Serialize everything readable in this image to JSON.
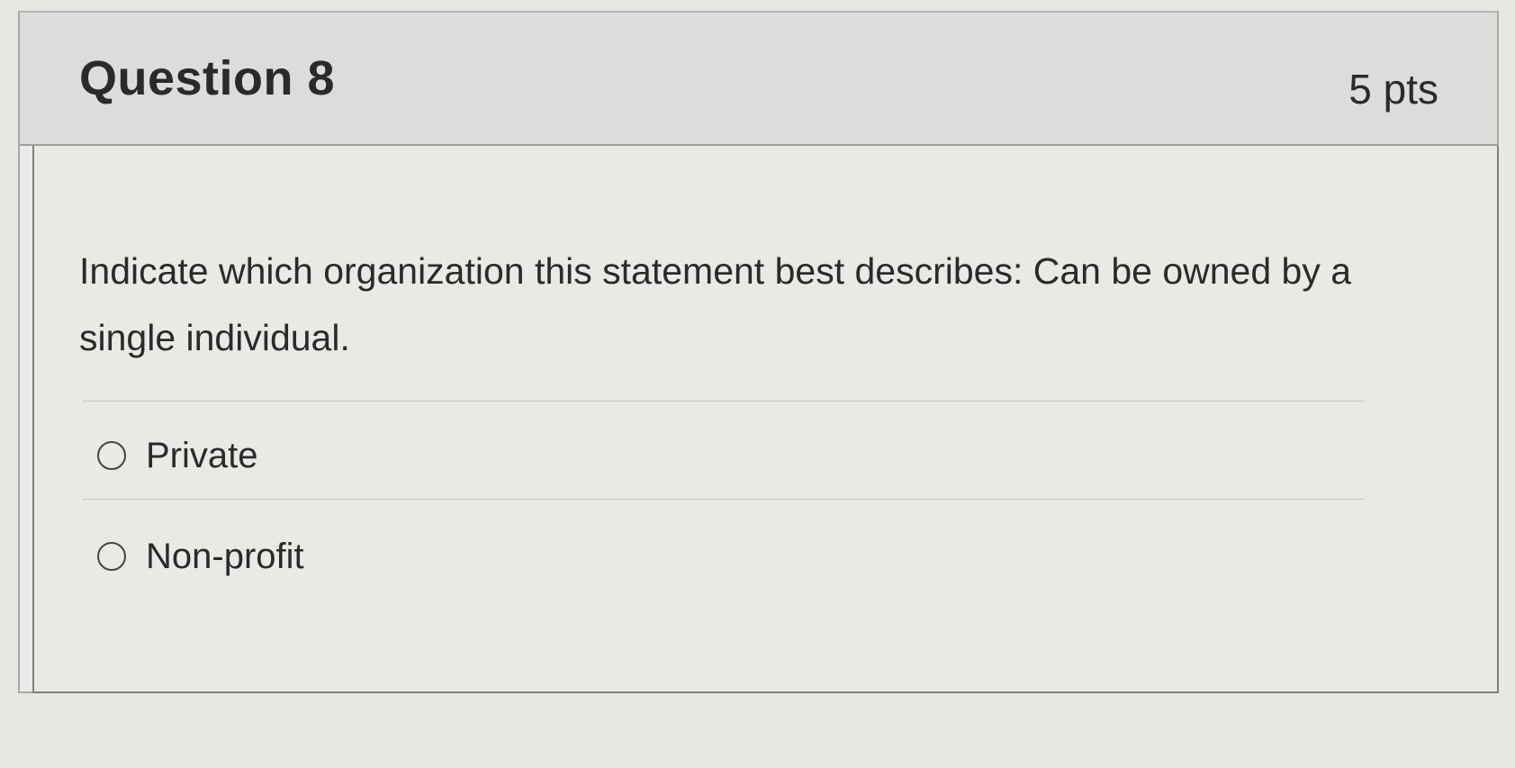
{
  "question": {
    "title": "Question 8",
    "points": "5 pts",
    "text": "Indicate which organization this statement best describes: Can be owned by a single individual."
  },
  "answers": [
    {
      "label": "Private",
      "selected": false
    },
    {
      "label": "Non-profit",
      "selected": false
    }
  ]
}
